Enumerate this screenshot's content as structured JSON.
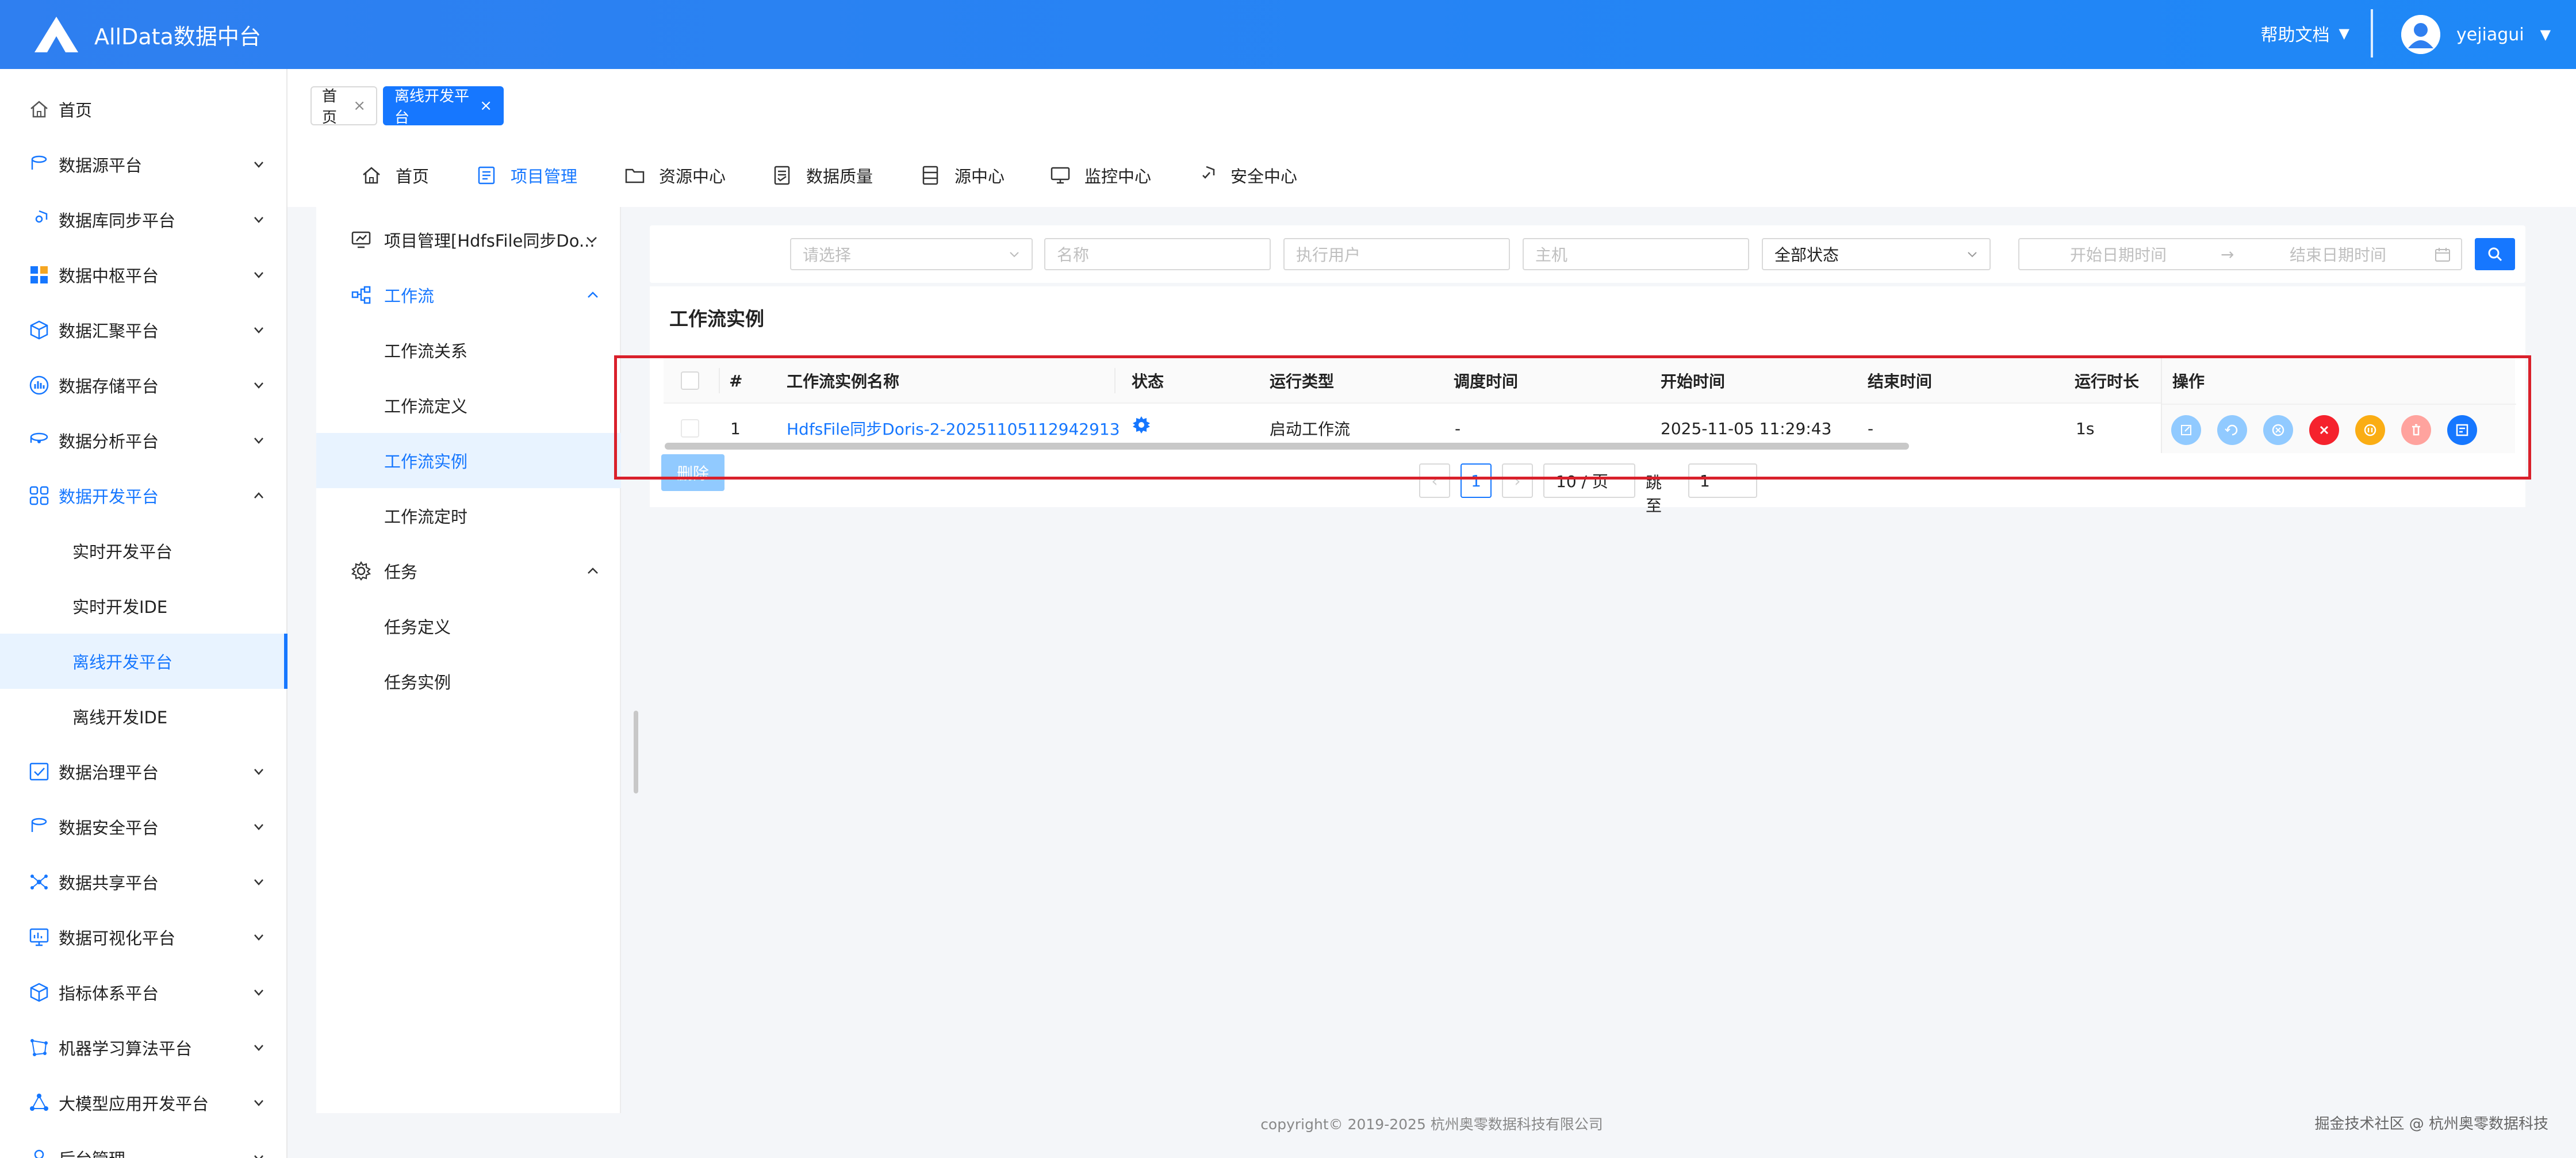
{
  "header": {
    "title": "AllData数据中台",
    "help_label": "帮助文档",
    "username": "yejiagui"
  },
  "sidebar": {
    "items": [
      {
        "label": "首页",
        "icon": "home-icon"
      },
      {
        "label": "数据源平台",
        "icon": "database-icon"
      },
      {
        "label": "数据库同步平台",
        "icon": "sync-shield-icon"
      },
      {
        "label": "数据中枢平台",
        "icon": "hub-blocks-icon"
      },
      {
        "label": "数据汇聚平台",
        "icon": "cube-icon"
      },
      {
        "label": "数据存储平台",
        "icon": "storage-chart-icon"
      },
      {
        "label": "数据分析平台",
        "icon": "analysis-icon"
      },
      {
        "label": "数据开发平台",
        "icon": "develop-grid-icon"
      },
      {
        "label": "实时开发平台"
      },
      {
        "label": "实时开发IDE"
      },
      {
        "label": "离线开发平台"
      },
      {
        "label": "离线开发IDE"
      },
      {
        "label": "数据治理平台",
        "icon": "governance-icon"
      },
      {
        "label": "数据安全平台",
        "icon": "security-db-icon"
      },
      {
        "label": "数据共享平台",
        "icon": "share-network-icon"
      },
      {
        "label": "数据可视化平台",
        "icon": "monitor-chart-icon"
      },
      {
        "label": "指标体系平台",
        "icon": "metric-cube-icon"
      },
      {
        "label": "机器学习算法平台",
        "icon": "ml-graph-icon"
      },
      {
        "label": "大模型应用开发平台",
        "icon": "llm-nodes-icon"
      },
      {
        "label": "后台管理",
        "icon": "admin-icon"
      }
    ]
  },
  "tabs": [
    {
      "label": "首页"
    },
    {
      "label": "离线开发平台"
    }
  ],
  "topnav": [
    {
      "label": "首页",
      "icon": "home-icon"
    },
    {
      "label": "项目管理",
      "icon": "project-icon"
    },
    {
      "label": "资源中心",
      "icon": "folder-icon"
    },
    {
      "label": "数据质量",
      "icon": "quality-doc-icon"
    },
    {
      "label": "源中心",
      "icon": "server-icon"
    },
    {
      "label": "监控中心",
      "icon": "monitor-icon"
    },
    {
      "label": "安全中心",
      "icon": "shield-check-icon"
    }
  ],
  "subnav": {
    "project": "项目管理[HdfsFile同步Do...",
    "workflow": "工作流",
    "workflow_items": [
      "工作流关系",
      "工作流定义",
      "工作流实例",
      "工作流定时"
    ],
    "task": "任务",
    "task_items": [
      "任务定义",
      "任务实例"
    ]
  },
  "filters": {
    "select_placeholder": "请选择",
    "name_placeholder": "名称",
    "user_placeholder": "执行用户",
    "host_placeholder": "主机",
    "status_value": "全部状态",
    "start_placeholder": "开始日期时间",
    "end_placeholder": "结束日期时间"
  },
  "card": {
    "title": "工作流实例"
  },
  "table": {
    "columns": [
      "#",
      "工作流实例名称",
      "状态",
      "运行类型",
      "调度时间",
      "开始时间",
      "结束时间",
      "运行时长",
      "操作"
    ],
    "rows": [
      {
        "index": "1",
        "name": "HdfsFile同步Doris-2-20251105112942913",
        "status_icon": "running-gear-icon",
        "run_type": "启动工作流",
        "schedule_time": "-",
        "start_time": "2025-11-05 11:29:43",
        "end_time": "-",
        "duration": "1s"
      }
    ],
    "actions": [
      {
        "name": "edit-icon",
        "color": "#91caff"
      },
      {
        "name": "rerun-icon",
        "color": "#91caff"
      },
      {
        "name": "recover-icon",
        "color": "#91caff"
      },
      {
        "name": "stop-icon",
        "color": "#f5222d"
      },
      {
        "name": "pause-icon",
        "color": "#faad14"
      },
      {
        "name": "delete-icon",
        "color": "#ffa39e"
      },
      {
        "name": "gantt-icon",
        "color": "#1677ff"
      }
    ]
  },
  "delete_label": "删除",
  "pagination": {
    "current": "1",
    "page_size": "10 / 页",
    "jump_label": "跳至",
    "jump_value": "1"
  },
  "footer": "copyright© 2019-2025 杭州奥零数据科技有限公司",
  "watermark": "掘金技术社区 @ 杭州奥零数据科技",
  "colors": {
    "primary": "#1677ff",
    "header": "#2f7ff0",
    "highlight_box": "#d9202b"
  }
}
